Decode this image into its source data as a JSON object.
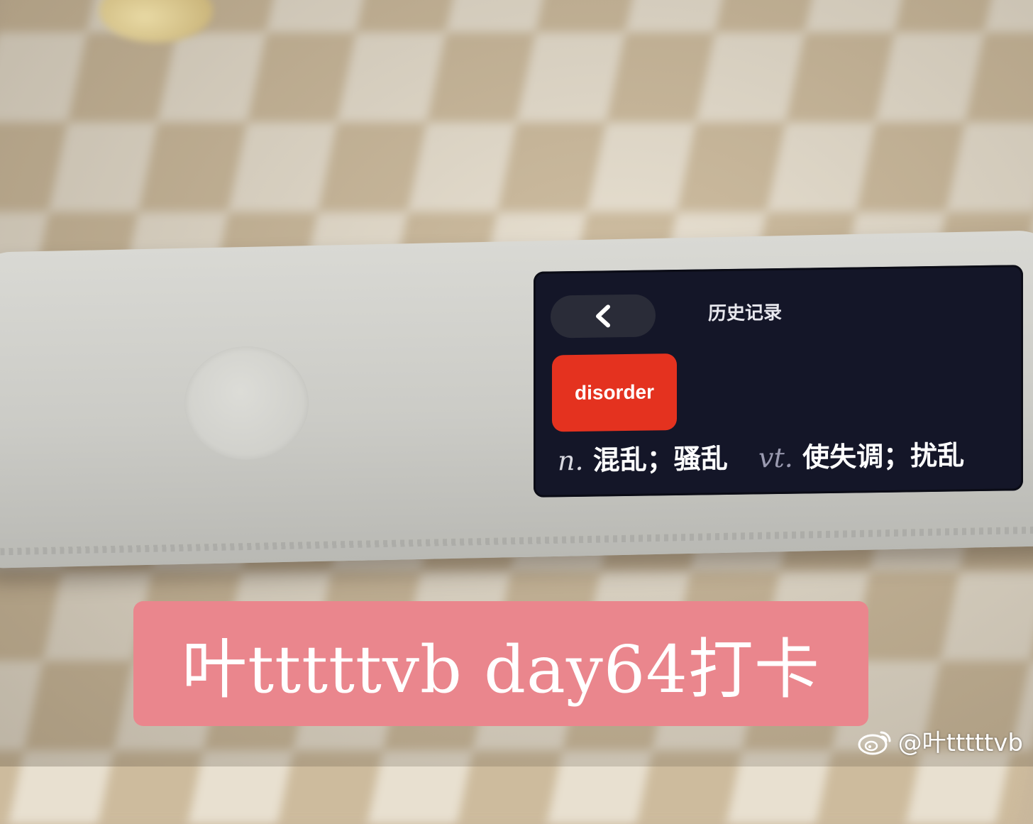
{
  "device_screen": {
    "title": "历史记录",
    "back_icon": "chevron-left-icon",
    "word": "disorder",
    "definition": {
      "pos_noun": "n.",
      "noun_meaning": "混乱；骚乱",
      "pos_verb": "vt.",
      "verb_meaning": "使失调；扰乱"
    },
    "colors": {
      "screen_bg": "#141628",
      "word_card": "#e4321f"
    }
  },
  "caption": {
    "text": "叶tttttvb day64打卡",
    "background": "#ea868d"
  },
  "watermark": {
    "icon": "weibo-logo-icon",
    "text": "@叶tttttvb"
  }
}
